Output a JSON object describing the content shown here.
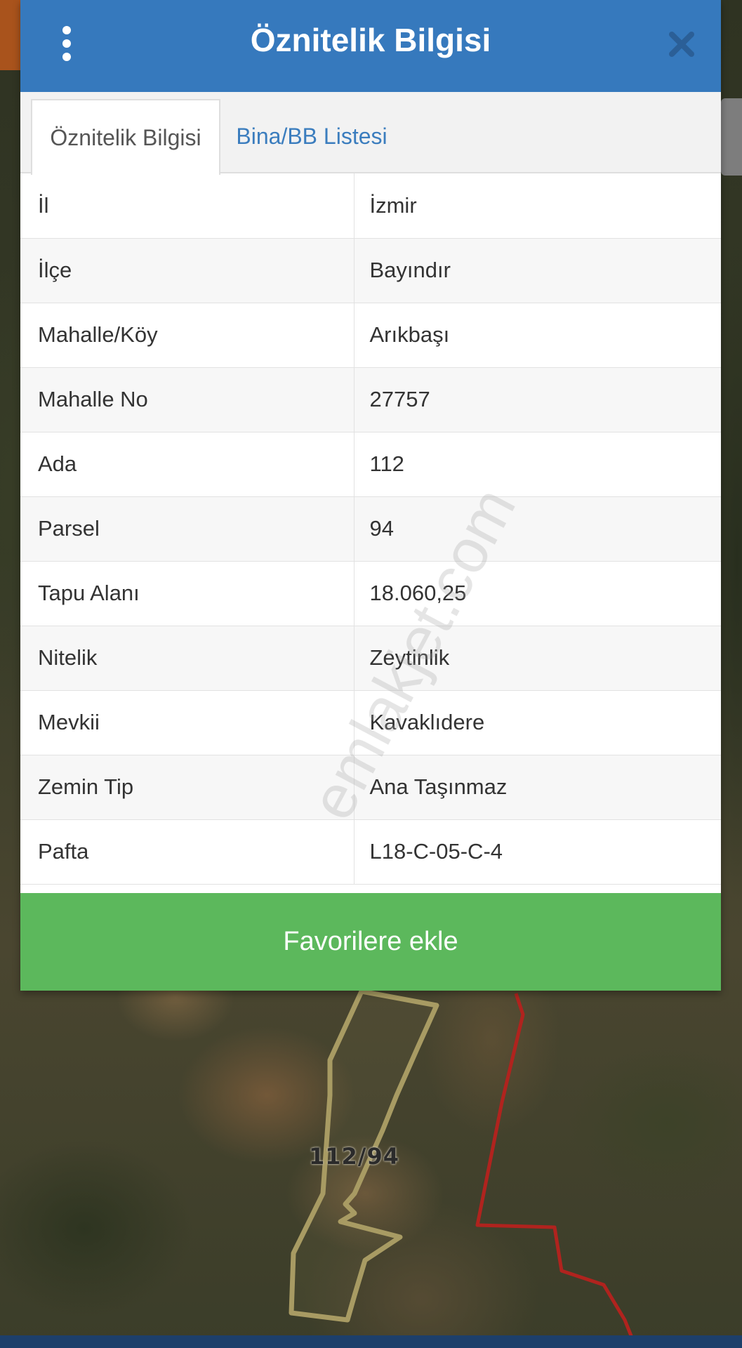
{
  "dialog": {
    "title": "Öznitelik Bilgisi",
    "menu_icon": "vertical-dots-icon",
    "close_icon": "close-icon",
    "header_color": "#3679bd"
  },
  "tabs": [
    {
      "label": "Öznitelik Bilgisi",
      "active": true
    },
    {
      "label": "Bina/BB Listesi",
      "active": false
    }
  ],
  "attributes": [
    {
      "key": "İl",
      "value": "İzmir"
    },
    {
      "key": "İlçe",
      "value": "Bayındır"
    },
    {
      "key": "Mahalle/Köy",
      "value": "Arıkbaşı"
    },
    {
      "key": "Mahalle No",
      "value": "27757"
    },
    {
      "key": "Ada",
      "value": "112"
    },
    {
      "key": "Parsel",
      "value": "94"
    },
    {
      "key": "Tapu Alanı",
      "value": "18.060,25"
    },
    {
      "key": "Nitelik",
      "value": "Zeytinlik"
    },
    {
      "key": "Mevkii",
      "value": "Kavaklıdere"
    },
    {
      "key": "Zemin Tip",
      "value": "Ana Taşınmaz"
    },
    {
      "key": "Pafta",
      "value": "L18-C-05-C-4"
    }
  ],
  "favorite_button": {
    "label": "Favorilere ekle",
    "color": "#5cb85c"
  },
  "watermark": "emlakjet.com",
  "map": {
    "parcel_label": "112/94",
    "parcel_outline_color": "#a89b63",
    "boundary_color": "#b0231e"
  }
}
